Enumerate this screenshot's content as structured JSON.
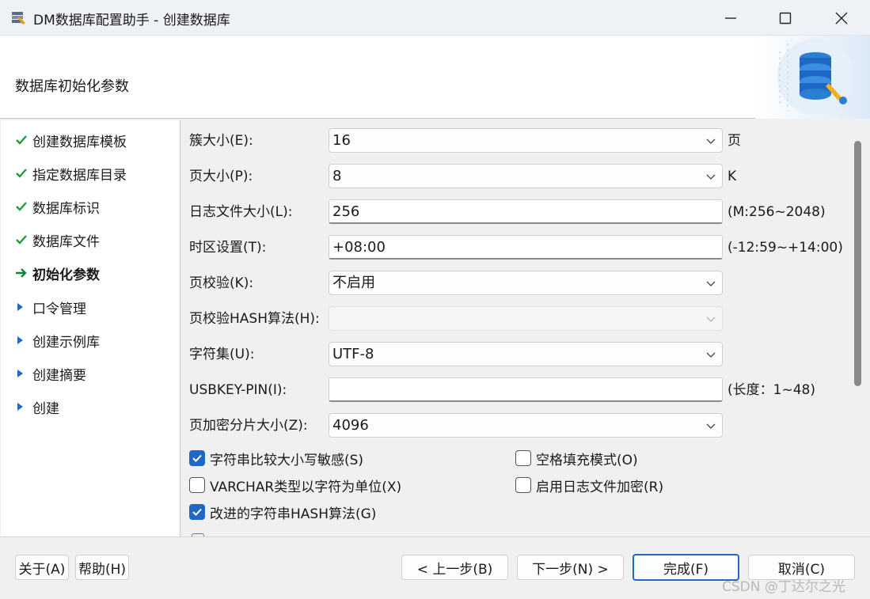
{
  "window": {
    "title": "DM数据库配置助手 - 创建数据库"
  },
  "header": {
    "title": "数据库初始化参数"
  },
  "nav": {
    "items": [
      {
        "label": "创建数据库模板",
        "state": "done"
      },
      {
        "label": "指定数据库目录",
        "state": "done"
      },
      {
        "label": "数据库标识",
        "state": "done"
      },
      {
        "label": "数据库文件",
        "state": "done"
      },
      {
        "label": "初始化参数",
        "state": "current"
      },
      {
        "label": "口令管理",
        "state": "pending"
      },
      {
        "label": "创建示例库",
        "state": "pending"
      },
      {
        "label": "创建摘要",
        "state": "pending"
      },
      {
        "label": "创建",
        "state": "pending"
      }
    ]
  },
  "form": {
    "extent_size": {
      "label": "簇大小(E):",
      "value": "16",
      "unit": "页"
    },
    "page_size": {
      "label": "页大小(P):",
      "value": "8",
      "unit": "K"
    },
    "log_size": {
      "label": "日志文件大小(L):",
      "value": "256",
      "unit": "(M:256~2048)"
    },
    "timezone": {
      "label": "时区设置(T):",
      "value": "+08:00",
      "unit": "(-12:59~+14:00)"
    },
    "page_check": {
      "label": "页校验(K):",
      "value": "不启用"
    },
    "page_check_hash": {
      "label": "页校验HASH算法(H):",
      "value": ""
    },
    "charset": {
      "label": "字符集(U):",
      "value": "UTF-8"
    },
    "usbkey_pin": {
      "label": "USBKEY-PIN(I):",
      "value": "",
      "unit": "(长度：1~48)"
    },
    "encrypt_slice": {
      "label": "页加密分片大小(Z):",
      "value": "4096"
    }
  },
  "options": {
    "case_sensitive": {
      "label": "字符串比较大小写敏感(S)",
      "checked": true
    },
    "blank_pad": {
      "label": "空格填充模式(O)",
      "checked": false
    },
    "varchar_char": {
      "label": "VARCHAR类型以字符为单位(X)",
      "checked": false
    },
    "log_encrypt": {
      "label": "启用日志文件加密(R)",
      "checked": false
    },
    "improved_hash": {
      "label": "改进的字符串HASH算法(G)",
      "checked": true
    }
  },
  "footer": {
    "about": "关于(A)",
    "help": "帮助(H)",
    "prev": "< 上一步(B)",
    "next": "下一步(N) >",
    "finish": "完成(F)",
    "cancel": "取消(C)"
  },
  "watermark": "CSDN @丁达尔之光",
  "colors": {
    "accent": "#1f68c4",
    "check_green": "#1f9e3a",
    "arrow_green": "#16803a",
    "nav_arrow_blue": "#1f68c4"
  }
}
